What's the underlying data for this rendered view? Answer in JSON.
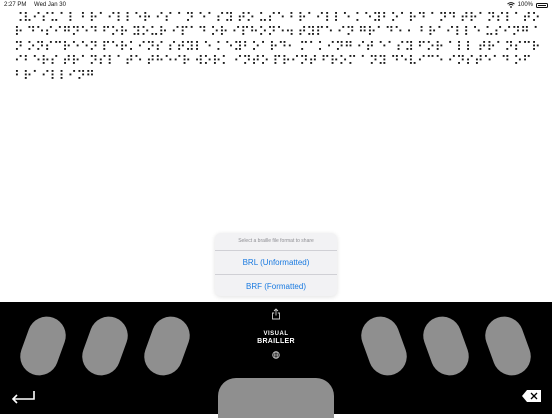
{
  "status_bar": {
    "time": "2:27 PM",
    "date": "Wed Jan 30",
    "battery": "100%"
  },
  "braille_text": "⠨⠧⠊⠎⠥⠁⠇ ⠃⠗⠁⠊⠇⠇⠑⠗ ⠊⠎ ⠁⠝ ⠑⠁⠎⠽ ⠞⠕ ⠥⠎⠑ ⠃⠗⠁⠊⠇⠇⠑ ⠅⠑⠽⠃⠕⠁⠗⠙ ⠁⠝⠙ ⠞⠗⠁⠝⠎⠇⠁⠞⠕⠗ ⠙⠑⠎⠊⠛⠝⠑⠙ ⠋⠕⠗ ⠽⠕⠥⠗ ⠊⠏⠁⠙ ⠕⠗ ⠊⠏⠓⠕⠝⠑⠲ ⠞⠽⠏⠑ ⠊⠝ ⠛⠗⠁⠙⠑ ⠂ ⠃⠗⠁⠊⠇⠇⠑ ⠥⠎⠊⠝⠛ ⠁⠝ ⠕⠝⠎⠉⠗⠑⠑⠝ ⠏⠑⠗⠅⠊⠝⠎ ⠎⠞⠽⠇⠑ ⠅⠑⠽⠃⠕⠁⠗⠙⠂ ⠍⠁⠅⠊⠝⠛ ⠊⠞ ⠑⠁⠎⠽ ⠋⠕⠗ ⠁⠇⠇ ⠞⠗⠁⠝⠎⠉⠗⠊⠃⠑⠗⠎ ⠞⠗⠁⠝⠎⠇⠁⠞⠑ ⠞⠓⠑⠊⠗ ⠺⠕⠗⠅ ⠊⠝⠞⠕ ⠏⠗⠊⠝⠞ ⠋⠗⠕⠍ ⠁⠝⠽ ⠙⠑⠧⠊⠉⠑ ⠊⠝⠎⠞⠑⠁⠙ ⠕⠋ ⠃⠗⠁⠊⠇⠇⠊⠝⠛",
  "share_sheet": {
    "header": "Select a braille file format to share",
    "options": [
      "BRL (Unformatted)",
      "BRF (Formatted)"
    ]
  },
  "keyboard": {
    "logo_line1": "VISUAL",
    "logo_line2": "BRAILLER",
    "key_color": "#8f8f8f",
    "background": "#000000"
  },
  "icons": {
    "share": "share-icon",
    "globe": "globe-icon",
    "return": "return-icon",
    "delete": "delete-icon",
    "wifi": "wifi-icon",
    "battery": "battery-icon"
  }
}
